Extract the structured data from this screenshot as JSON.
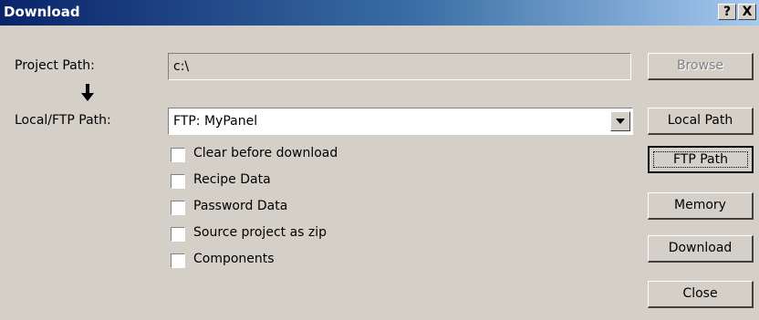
{
  "window": {
    "title": "Download",
    "help_glyph": "?",
    "close_glyph": "X"
  },
  "paths": {
    "project_label": "Project Path:",
    "project_value": "c:\\",
    "local_ftp_label": "Local/FTP Path:",
    "local_ftp_value": "FTP: MyPanel"
  },
  "options": [
    {
      "label": "Clear before download",
      "checked": false
    },
    {
      "label": "Recipe Data",
      "checked": false
    },
    {
      "label": "Password Data",
      "checked": false
    },
    {
      "label": "Source project as zip",
      "checked": false
    },
    {
      "label": "Components",
      "checked": false
    }
  ],
  "buttons": {
    "browse": {
      "label": "Browse",
      "enabled": false
    },
    "local_path": {
      "label": "Local Path",
      "accesskey": "L"
    },
    "ftp_path": {
      "label": "FTP Path",
      "accesskey": "F"
    },
    "memory": {
      "label": "Memory"
    },
    "download": {
      "label": "Download",
      "accesskey": "D"
    },
    "close": {
      "label": "Close",
      "accesskey": "C"
    }
  },
  "icons": {
    "direction_arrow": "arrow-down-icon",
    "dropdown": "chevron-down-icon"
  }
}
